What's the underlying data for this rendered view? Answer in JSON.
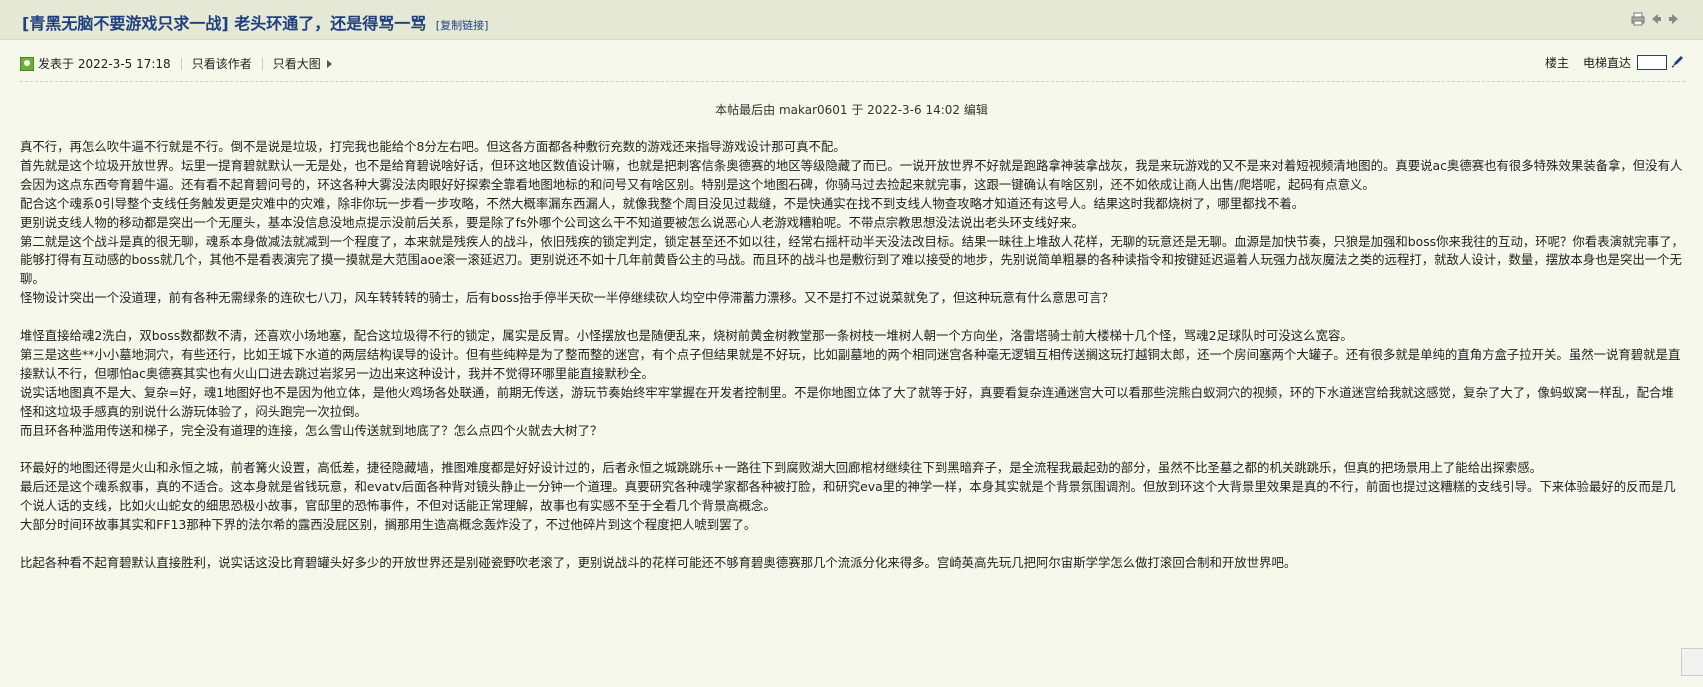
{
  "header": {
    "title": "[青黑无脑不要游戏只求一战] 老头环通了，还是得骂一骂",
    "copy_link": "[复制链接]",
    "icons": [
      "print-icon",
      "prev-thread-icon",
      "next-thread-icon"
    ]
  },
  "post_meta": {
    "posted": "发表于 2022-3-5 17:18",
    "only_author": "只看该作者",
    "only_images": "只看大图",
    "floor": "楼主",
    "elevator": "电梯直达",
    "jump_value": ""
  },
  "edit_note": "本帖最后由 makar0601 于 2022-3-6 14:02 编辑",
  "content": {
    "paragraphs": [
      "真不行，再怎么吹牛逼不行就是不行。倒不是说是垃圾，打完我也能给个8分左右吧。但这各方面都各种敷衍充数的游戏还来指导游戏设计那可真不配。",
      "首先就是这个垃圾开放世界。坛里一提育碧就默认一无是处，也不是给育碧说啥好话，但环这地区数值设计嘛，也就是把刺客信条奥德赛的地区等级隐藏了而已。一说开放世界不好就是跑路拿神装拿战灰，我是来玩游戏的又不是来对着短视频清地图的。真要说ac奥德赛也有很多特殊效果装备拿，但没有人会因为这点东西夸育碧牛逼。还有看不起育碧问号的，环这各种大雾没法肉眼好好探索全靠看地图地标的和问号又有啥区别。特别是这个地图石碑，你骑马过去捡起来就完事，这跟一键确认有啥区别，还不如依成让商人出售/爬塔呢，起码有点意义。",
      "配合这个魂系0引导整个支线任务触发更是灾难中的灾难，除非你玩一步看一步攻略，不然大概率漏东西漏人，就像我整个周目没见过裁缝，不是快通实在找不到支线人物查攻略才知道还有这号人。结果这时我都烧树了，哪里都找不着。",
      "更别说支线人物的移动都是突出一个无厘头，基本没信息没地点提示没前后关系，要是除了fs外哪个公司这么干不知道要被怎么说恶心人老游戏糟粕呢。不带点宗教思想没法说出老头环支线好来。",
      "第二就是这个战斗是真的很无聊，魂系本身做减法就减到一个程度了，本来就是残疾人的战斗，依旧残疾的锁定判定，锁定甚至还不如以往，经常右摇杆动半天没法改目标。结果一昧往上堆敌人花样，无聊的玩意还是无聊。血源是加快节奏，只狼是加强和boss你来我往的互动，环呢？你看表演就完事了，能够打得有互动感的boss就几个，其他不是看表演完了摸一摸就是大范围aoe滚一滚延迟刀。更别说还不如十几年前黄昏公主的马战。而且环的战斗也是敷衍到了难以接受的地步，先别说简单粗暴的各种读指令和按键延迟逼着人玩强力战灰魔法之类的远程打，就敌人设计，数量，摆放本身也是突出一个无聊。",
      "怪物设计突出一个没道理，前有各种无需绿条的连砍七八刀，风车转转转的骑士，后有boss抬手停半天砍一半停继续砍人均空中停滞蓄力漂移。又不是打不过说菜就免了，但这种玩意有什么意思可言？",
      "",
      "堆怪直接给魂2洗白，双boss数都数不清，还喜欢小场地塞，配合这垃圾得不行的锁定，属实是反胃。小怪摆放也是随便乱来，烧树前黄金树教堂那一条树枝一堆树人朝一个方向坐，洛雷塔骑士前大楼梯十几个怪，骂魂2足球队时可没这么宽容。",
      "第三是这些**小小墓地洞穴，有些还行，比如王城下水道的两层结构误导的设计。但有些纯粹是为了整而整的迷宫，有个点子但结果就是不好玩，比如副墓地的两个相同迷宫各种毫无逻辑互相传送搁这玩打越铜太郎，还一个房间塞两个大罐子。还有很多就是单纯的直角方盒子拉开关。虽然一说育碧就是直接默认不行，但哪怕ac奥德赛其实也有火山口进去跳过岩浆另一边出来这种设计，我并不觉得环哪里能直接默秒全。",
      "说实话地图真不是大、复杂=好，魂1地图好也不是因为他立体，是他火鸡场各处联通，前期无传送，游玩节奏始终牢牢掌握在开发者控制里。不是你地图立体了大了就等于好，真要看复杂连通迷宫大可以看那些浣熊白蚁洞穴的视频，环的下水道迷宫给我就这感觉，复杂了大了，像蚂蚁窝一样乱，配合堆怪和这垃圾手感真的别说什么游玩体验了，闷头跑完一次拉倒。",
      "而且环各种滥用传送和梯子，完全没有道理的连接，怎么雪山传送就到地底了？怎么点四个火就去大树了？",
      "",
      "环最好的地图还得是火山和永恒之城，前者篝火设置，高低差，捷径隐藏墙，推图难度都是好好设计过的，后者永恒之城跳跳乐+一路往下到腐败湖大回廊棺材继续往下到黑暗弃子，是全流程我最起劲的部分，虽然不比圣墓之都的机关跳跳乐，但真的把场景用上了能给出探索感。",
      "最后还是这个魂系叙事，真的不适合。这本身就是省钱玩意，和evatv后面各种背对镜头静止一分钟一个道理。真要研究各种魂学家都各种被打脸，和研究eva里的神学一样，本身其实就是个背景氛围调剂。但放到环这个大背景里效果是真的不行，前面也提过这糟糕的支线引导。下来体验最好的反而是几个说人话的支线，比如火山蛇女的细思恐极小故事，官邸里的恐怖事件，不但对话能正常理解，故事也有实感不至于全看几个背景高概念。",
      "大部分时间环故事其实和FF13那种下界的法尔希的露西没屁区别，搁那用生造高概念轰炸没了，不过他碎片到这个程度把人唬到罢了。",
      "",
      "比起各种看不起育碧默认直接胜利，说实话这没比育碧罐头好多少的开放世界还是别碰瓷野吹老滚了，更别说战斗的花样可能还不够育碧奥德赛那几个流派分化来得多。宫崎英高先玩几把阿尔宙斯学学怎么做打滚回合制和开放世界吧。"
    ]
  }
}
